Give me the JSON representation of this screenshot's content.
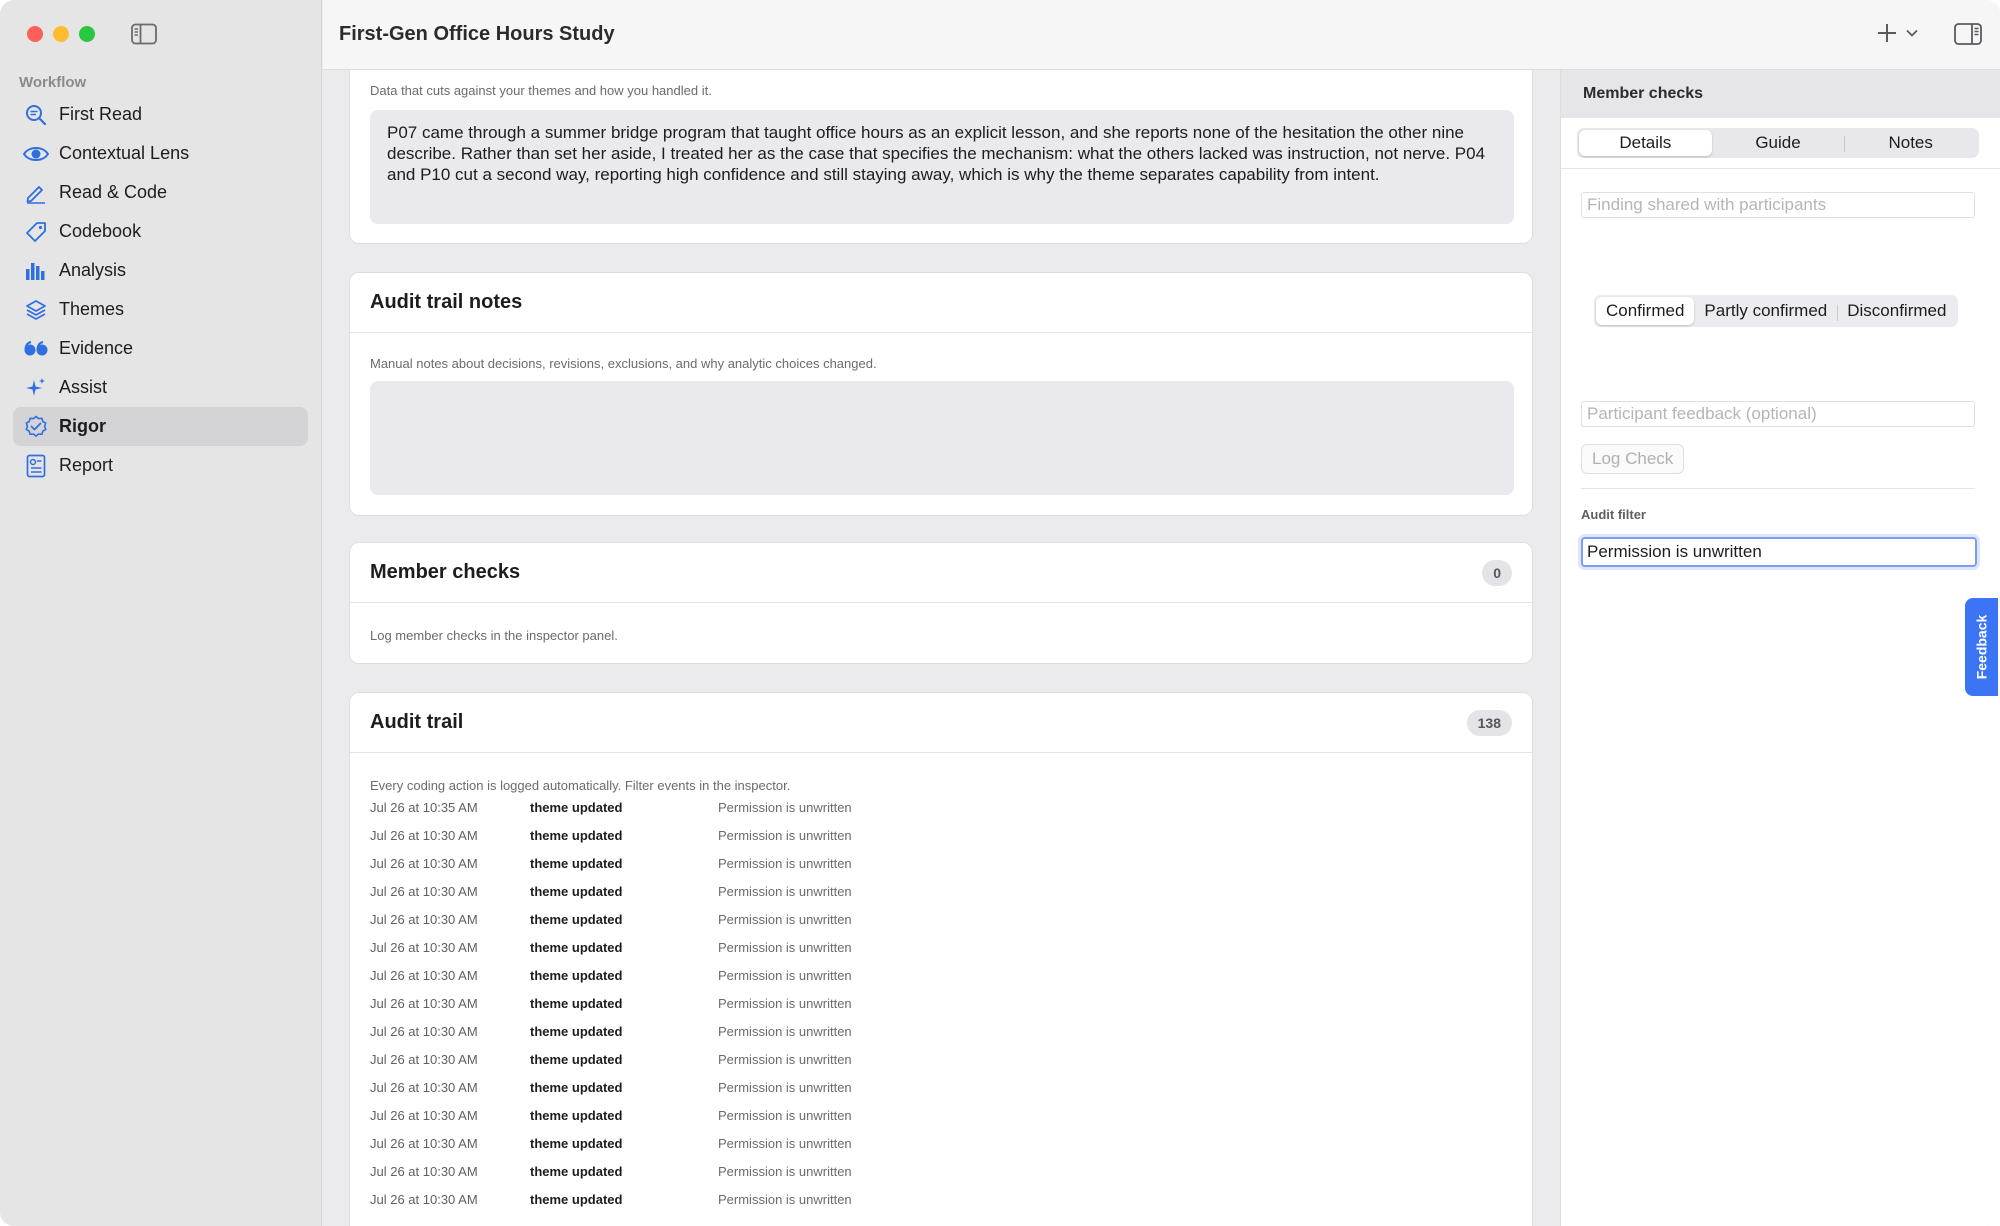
{
  "app": {
    "title": "First-Gen Office Hours Study"
  },
  "sidebar": {
    "heading": "Workflow",
    "items": [
      {
        "label": "First Read",
        "icon": "magnifier-text-icon"
      },
      {
        "label": "Contextual Lens",
        "icon": "eye-icon"
      },
      {
        "label": "Read & Code",
        "icon": "pencil-icon"
      },
      {
        "label": "Codebook",
        "icon": "tag-icon"
      },
      {
        "label": "Analysis",
        "icon": "bar-chart-icon"
      },
      {
        "label": "Themes",
        "icon": "layers-icon"
      },
      {
        "label": "Evidence",
        "icon": "quote-icon"
      },
      {
        "label": "Assist",
        "icon": "sparkle-icon"
      },
      {
        "label": "Rigor",
        "icon": "seal-check-icon",
        "active": true
      },
      {
        "label": "Report",
        "icon": "report-icon"
      }
    ]
  },
  "negative_cases": {
    "hint": "Data that cuts against your themes and how you handled it.",
    "text": "P07 came through a summer bridge program that taught office hours as an explicit lesson, and she reports none of the hesitation the other nine describe. Rather than set her aside, I treated her as the case that specifies the mechanism: what the others lacked was instruction, not nerve. P04 and P10 cut a second way, reporting high confidence and still staying away, which is why the theme separates capability from intent."
  },
  "audit_notes": {
    "title": "Audit trail notes",
    "hint": "Manual notes about decisions, revisions, exclusions, and why analytic choices changed."
  },
  "member_checks_card": {
    "title": "Member checks",
    "count": "0",
    "hint": "Log member checks in the inspector panel."
  },
  "audit_trail": {
    "title": "Audit trail",
    "count": "138",
    "hint": "Every coding action is logged automatically. Filter events in the inspector.",
    "rows": [
      {
        "when": "Jul 26 at 10:35 AM",
        "what": "theme updated",
        "detail": "Permission is unwritten"
      },
      {
        "when": "Jul 26 at 10:30 AM",
        "what": "theme updated",
        "detail": "Permission is unwritten"
      },
      {
        "when": "Jul 26 at 10:30 AM",
        "what": "theme updated",
        "detail": "Permission is unwritten"
      },
      {
        "when": "Jul 26 at 10:30 AM",
        "what": "theme updated",
        "detail": "Permission is unwritten"
      },
      {
        "when": "Jul 26 at 10:30 AM",
        "what": "theme updated",
        "detail": "Permission is unwritten"
      },
      {
        "when": "Jul 26 at 10:30 AM",
        "what": "theme updated",
        "detail": "Permission is unwritten"
      },
      {
        "when": "Jul 26 at 10:30 AM",
        "what": "theme updated",
        "detail": "Permission is unwritten"
      },
      {
        "when": "Jul 26 at 10:30 AM",
        "what": "theme updated",
        "detail": "Permission is unwritten"
      },
      {
        "when": "Jul 26 at 10:30 AM",
        "what": "theme updated",
        "detail": "Permission is unwritten"
      },
      {
        "when": "Jul 26 at 10:30 AM",
        "what": "theme updated",
        "detail": "Permission is unwritten"
      },
      {
        "when": "Jul 26 at 10:30 AM",
        "what": "theme updated",
        "detail": "Permission is unwritten"
      },
      {
        "when": "Jul 26 at 10:30 AM",
        "what": "theme updated",
        "detail": "Permission is unwritten"
      },
      {
        "when": "Jul 26 at 10:30 AM",
        "what": "theme updated",
        "detail": "Permission is unwritten"
      },
      {
        "when": "Jul 26 at 10:30 AM",
        "what": "theme updated",
        "detail": "Permission is unwritten"
      },
      {
        "when": "Jul 26 at 10:30 AM",
        "what": "theme updated",
        "detail": "Permission is unwritten"
      }
    ]
  },
  "inspector": {
    "title": "Member checks",
    "tabs": [
      "Details",
      "Guide",
      "Notes"
    ],
    "selected_tab": "Details",
    "finding_placeholder": "Finding shared with participants",
    "statuses": [
      "Confirmed",
      "Partly confirmed",
      "Disconfirmed"
    ],
    "selected_status": "Confirmed",
    "feedback_placeholder": "Participant feedback (optional)",
    "log_button": "Log Check",
    "audit_filter_label": "Audit filter",
    "audit_filter_value": "Permission is unwritten"
  },
  "feedback_tab": "Feedback",
  "colors": {
    "accent": "#2f6fe0",
    "focus_ring": "#7d9cf0",
    "feedback": "#3b74f5"
  }
}
